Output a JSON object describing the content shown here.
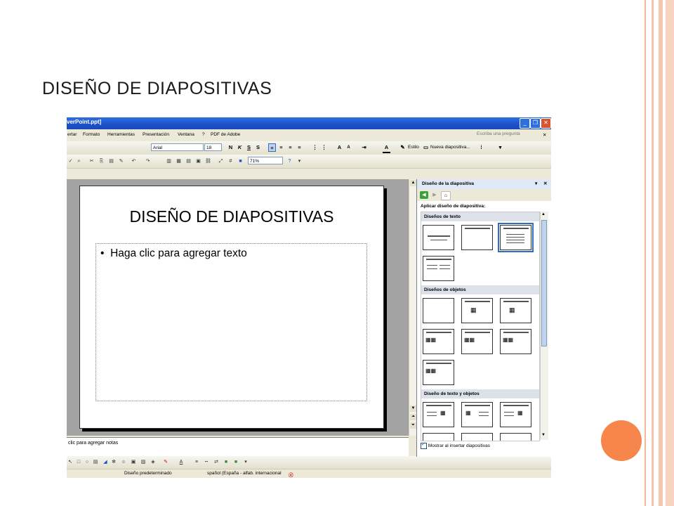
{
  "page": {
    "heading": "DISEÑO DE DIAPOSITIVAS"
  },
  "window": {
    "title": "verPoint.ppt]",
    "ask_placeholder": "Escriba una pregunta",
    "menu": [
      "ertar",
      "Formato",
      "Herramientas",
      "Presentación",
      "Ventana",
      "?",
      "PDF de Adobe"
    ]
  },
  "toolbar": {
    "font_name": "Arial",
    "font_size": "18",
    "bold": "N",
    "italic": "K",
    "underline": "S",
    "shadow": "S",
    "style_label": "Estilo",
    "new_slide_label": "Nueva diapositiva...",
    "zoom": "71%"
  },
  "slide": {
    "title": "DISEÑO DE DIAPOSITIVAS",
    "bullet": "•",
    "body_placeholder": "Haga clic para agregar texto"
  },
  "notes": {
    "placeholder": "clic para agregar notas"
  },
  "statusbar": {
    "design": "Diseño predeterminado",
    "language": "spañol (España - alfab. internacional"
  },
  "taskpane": {
    "title": "Diseño de la diapositiva",
    "apply_label": "Aplicar diseño de diapositiva:",
    "sections": [
      "Diseños de texto",
      "Diseños de objetos",
      "Diseño de texto y objetos"
    ],
    "show_on_insert": "Mostrar al insertar diapositivas",
    "show_on_insert_checked": true
  },
  "colors": {
    "accent_orange": "#f7864c",
    "xp_blue": "#2e6fe0",
    "workspace_gray": "#a3a3a3"
  }
}
